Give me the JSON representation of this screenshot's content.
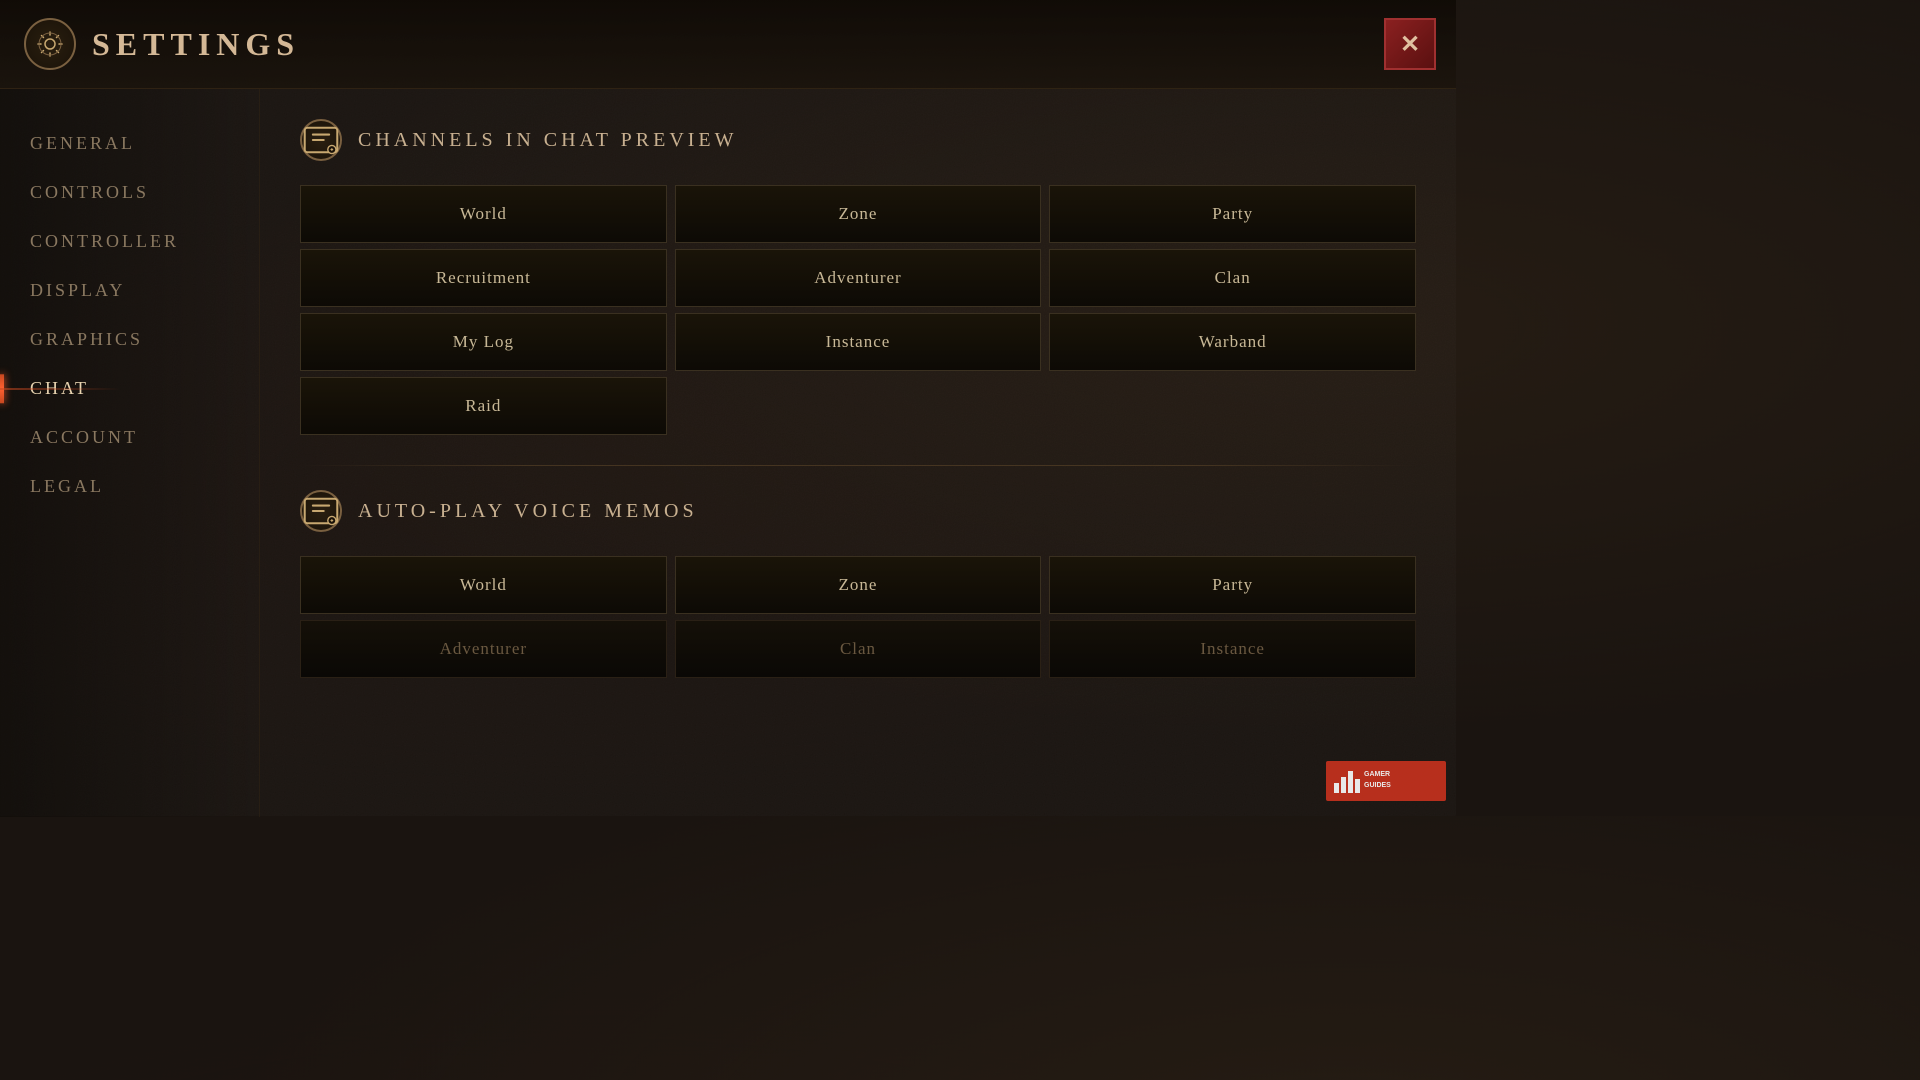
{
  "header": {
    "title": "SETTINGS",
    "close_label": "✕"
  },
  "sidebar": {
    "items": [
      {
        "id": "general",
        "label": "GENERAL",
        "active": false
      },
      {
        "id": "controls",
        "label": "CONTROLS",
        "active": false
      },
      {
        "id": "controller",
        "label": "CONTROLLER",
        "active": false
      },
      {
        "id": "display",
        "label": "DISPLAY",
        "active": false
      },
      {
        "id": "graphics",
        "label": "GRAPHICS",
        "active": false
      },
      {
        "id": "chat",
        "label": "CHAT",
        "active": true
      },
      {
        "id": "account",
        "label": "ACCOUNT",
        "active": false
      },
      {
        "id": "legal",
        "label": "LEGAL",
        "active": false
      }
    ]
  },
  "sections": {
    "channels_preview": {
      "title": "CHANNELS IN CHAT PREVIEW",
      "buttons": [
        {
          "id": "world",
          "label": "World",
          "active": false
        },
        {
          "id": "zone",
          "label": "Zone",
          "active": false
        },
        {
          "id": "party",
          "label": "Party",
          "active": false
        },
        {
          "id": "recruitment",
          "label": "Recruitment",
          "active": false
        },
        {
          "id": "adventurer",
          "label": "Adventurer",
          "active": false
        },
        {
          "id": "clan",
          "label": "Clan",
          "active": false
        },
        {
          "id": "mylog",
          "label": "My Log",
          "active": false
        },
        {
          "id": "instance",
          "label": "Instance",
          "active": false
        },
        {
          "id": "warband",
          "label": "Warband",
          "active": false
        },
        {
          "id": "raid",
          "label": "Raid",
          "active": false
        }
      ]
    },
    "auto_play": {
      "title": "AUTO-PLAY VOICE MEMOS",
      "buttons_row1": [
        {
          "id": "world2",
          "label": "World",
          "active": false
        },
        {
          "id": "zone2",
          "label": "Zone",
          "active": false
        },
        {
          "id": "party2",
          "label": "Party",
          "active": false
        }
      ],
      "buttons_row2": [
        {
          "id": "adventurer2",
          "label": "Adventurer",
          "active": false,
          "dimmed": true
        },
        {
          "id": "clan2",
          "label": "Clan",
          "active": false,
          "dimmed": true
        },
        {
          "id": "instance2",
          "label": "Instance",
          "active": false,
          "dimmed": true
        }
      ]
    }
  },
  "watermark": {
    "label": "GAMER GUIDES"
  }
}
